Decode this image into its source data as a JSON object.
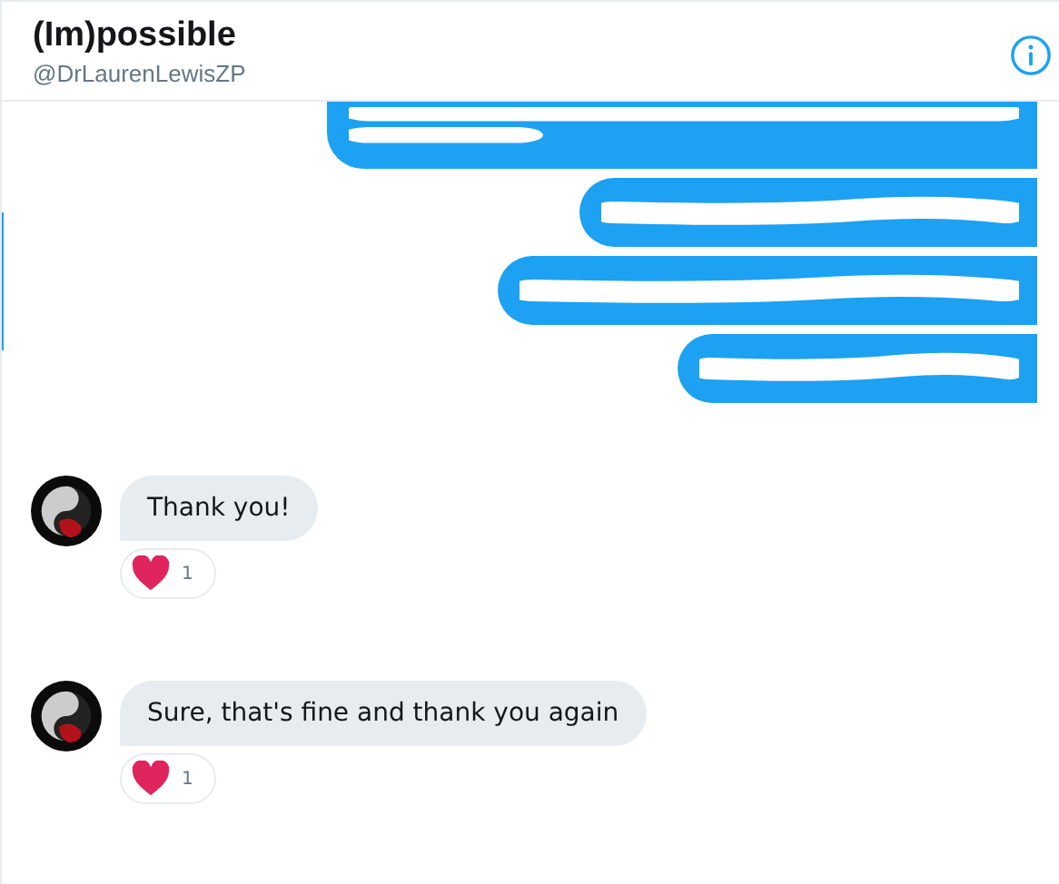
{
  "header": {
    "title": "(Im)possible",
    "handle": "@DrLaurenLewisZP"
  },
  "sent_messages": [
    {
      "kind": "redacted"
    },
    {
      "kind": "redacted"
    },
    {
      "kind": "redacted"
    },
    {
      "kind": "redacted"
    }
  ],
  "received_messages": [
    {
      "text": "Thank you!",
      "reaction": {
        "kind": "heart",
        "count": "1"
      }
    },
    {
      "text": "Sure, that's fine and thank you again",
      "reaction": {
        "kind": "heart",
        "count": "1"
      }
    }
  ]
}
